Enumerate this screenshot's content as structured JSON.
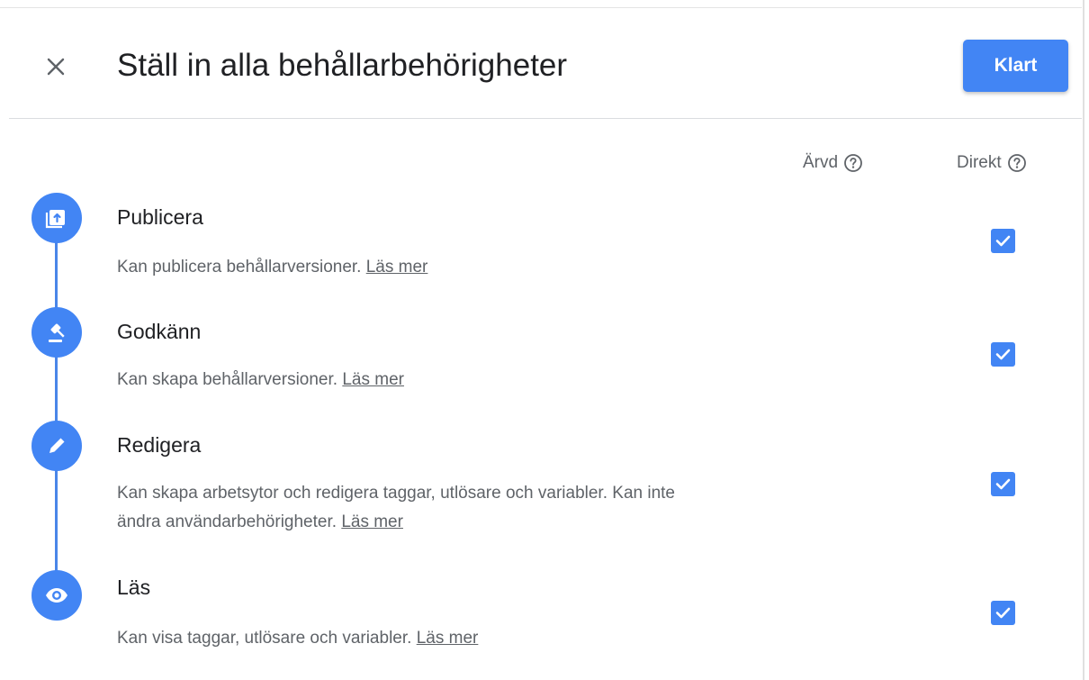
{
  "dialog": {
    "title": "Ställ in alla behållarbehörigheter",
    "close_icon": "close-icon",
    "done_label": "Klart"
  },
  "columns": {
    "inherited": "Ärvd",
    "direct": "Direkt",
    "help_icon": "help-circle-icon"
  },
  "accent_color": "#4285f4",
  "permissions": [
    {
      "icon": "publish-icon",
      "title": "Publicera",
      "description": "Kan publicera behållarversioner.",
      "link": "Läs mer",
      "direct_checked": true
    },
    {
      "icon": "gavel-icon",
      "title": "Godkänn",
      "description": "Kan skapa behållarversioner.",
      "link": "Läs mer",
      "direct_checked": true
    },
    {
      "icon": "pencil-icon",
      "title": "Redigera",
      "description": "Kan skapa arbetsytor och redigera taggar, utlösare och variabler. Kan inte ändra användarbehörigheter.",
      "link": "Läs mer",
      "direct_checked": true
    },
    {
      "icon": "eye-icon",
      "title": "Läs",
      "description": "Kan visa taggar, utlösare och variabler.",
      "link": "Läs mer",
      "direct_checked": true
    }
  ]
}
